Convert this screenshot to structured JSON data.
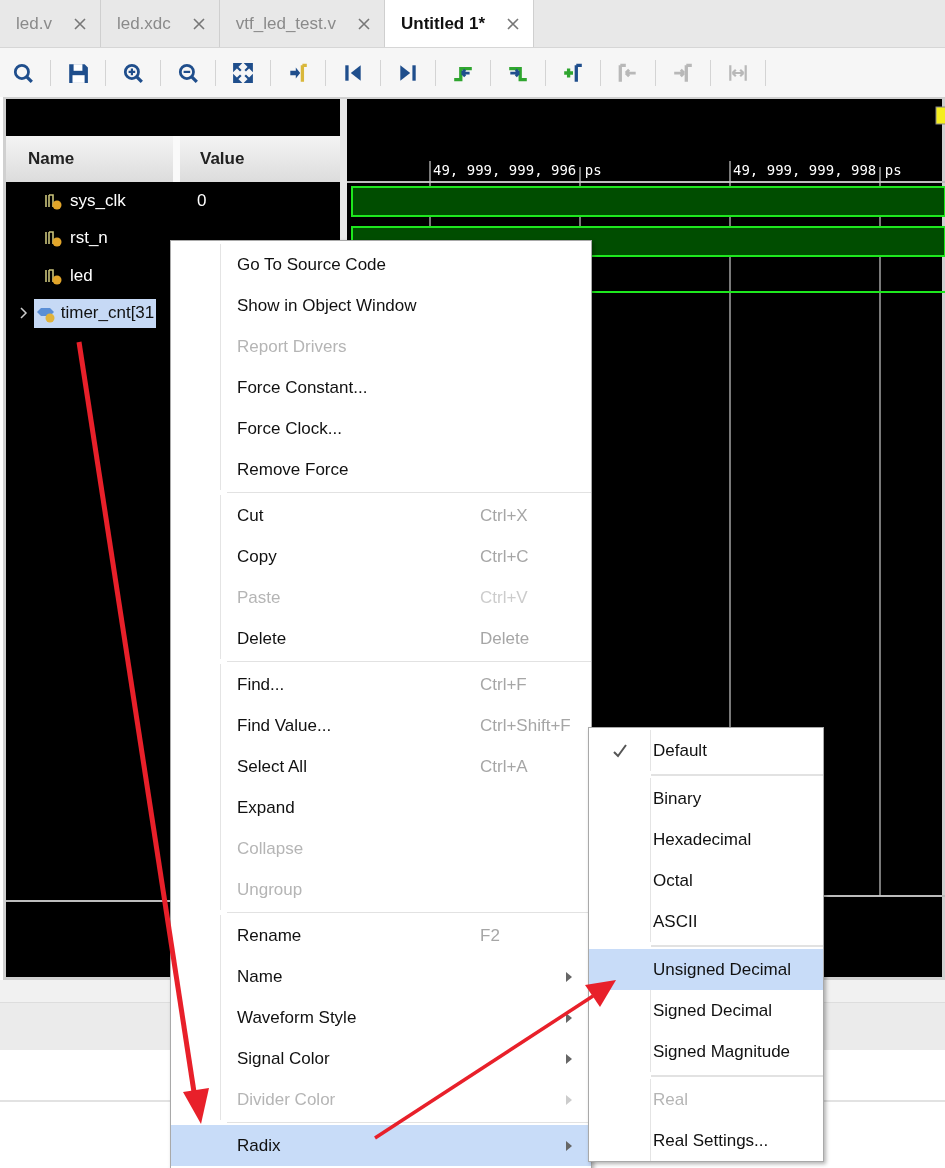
{
  "tabs": [
    {
      "label": "led.v",
      "selected": false
    },
    {
      "label": "led.xdc",
      "selected": false
    },
    {
      "label": "vtf_led_test.v",
      "selected": false
    },
    {
      "label": "Untitled 1*",
      "selected": true
    }
  ],
  "toolbar": [
    {
      "kind": "search",
      "disabled": false
    },
    {
      "kind": "save",
      "disabled": false
    },
    {
      "kind": "zoom-in",
      "disabled": false
    },
    {
      "kind": "zoom-out",
      "disabled": false
    },
    {
      "kind": "fit",
      "disabled": false
    },
    {
      "kind": "go-cursor",
      "disabled": false
    },
    {
      "kind": "go-start",
      "disabled": false
    },
    {
      "kind": "go-end",
      "disabled": false
    },
    {
      "kind": "prev-edge",
      "disabled": false
    },
    {
      "kind": "next-edge",
      "disabled": false
    },
    {
      "kind": "add-marker",
      "disabled": false
    },
    {
      "kind": "prev-marker",
      "disabled": true
    },
    {
      "kind": "next-marker",
      "disabled": true
    },
    {
      "kind": "swap",
      "disabled": true
    }
  ],
  "signals_table": {
    "columns": [
      "Name",
      "Value"
    ],
    "rows": [
      {
        "name": "sys_clk",
        "value": "0",
        "kind": "bit",
        "selected": false
      },
      {
        "name": "rst_n",
        "kind": "bit",
        "selected": false
      },
      {
        "name": "led",
        "kind": "bit",
        "selected": false
      },
      {
        "name": "timer_cnt[31",
        "kind": "bus",
        "expanded": false,
        "selected": true
      }
    ]
  },
  "waveforms": [
    {
      "kind": "band"
    },
    {
      "kind": "band"
    },
    {
      "kind": "low"
    }
  ],
  "ruler": [
    "49, 999, 999, 996 ps",
    "49, 999, 999, 998 ps"
  ],
  "context_menu": [
    {
      "kind": "item",
      "label": "Go To Source Code",
      "disabled": false,
      "selected": false
    },
    {
      "kind": "item",
      "label": "Show in Object Window",
      "disabled": false,
      "selected": false
    },
    {
      "kind": "item",
      "label": "Report Drivers",
      "disabled": true,
      "selected": false
    },
    {
      "kind": "item",
      "label": "Force Constant...",
      "disabled": false,
      "selected": false
    },
    {
      "kind": "item",
      "label": "Force Clock...",
      "disabled": false,
      "selected": false
    },
    {
      "kind": "item",
      "label": "Remove Force",
      "disabled": false,
      "selected": false
    },
    {
      "kind": "separator"
    },
    {
      "kind": "item",
      "label": "Cut",
      "shortcut": "Ctrl+X",
      "disabled": false,
      "selected": false
    },
    {
      "kind": "item",
      "label": "Copy",
      "shortcut": "Ctrl+C",
      "disabled": false,
      "selected": false
    },
    {
      "kind": "item",
      "label": "Paste",
      "shortcut": "Ctrl+V",
      "disabled": true,
      "selected": false
    },
    {
      "kind": "item",
      "label": "Delete",
      "shortcut": "Delete",
      "disabled": false,
      "selected": false
    },
    {
      "kind": "separator"
    },
    {
      "kind": "item",
      "label": "Find...",
      "shortcut": "Ctrl+F",
      "disabled": false,
      "selected": false
    },
    {
      "kind": "item",
      "label": "Find Value...",
      "shortcut": "Ctrl+Shift+F",
      "disabled": false,
      "selected": false
    },
    {
      "kind": "item",
      "label": "Select All",
      "shortcut": "Ctrl+A",
      "disabled": false,
      "selected": false
    },
    {
      "kind": "item",
      "label": "Expand",
      "disabled": false,
      "selected": false
    },
    {
      "kind": "item",
      "label": "Collapse",
      "disabled": true,
      "selected": false
    },
    {
      "kind": "item",
      "label": "Ungroup",
      "disabled": true,
      "selected": false
    },
    {
      "kind": "separator"
    },
    {
      "kind": "item",
      "label": "Rename",
      "shortcut": "F2",
      "disabled": false,
      "selected": false
    },
    {
      "kind": "item",
      "label": "Name",
      "submenu": true,
      "disabled": false,
      "selected": false
    },
    {
      "kind": "item",
      "label": "Waveform Style",
      "submenu": true,
      "disabled": false,
      "selected": false
    },
    {
      "kind": "item",
      "label": "Signal Color",
      "submenu": true,
      "disabled": false,
      "selected": false
    },
    {
      "kind": "item",
      "label": "Divider Color",
      "submenu": true,
      "disabled": true,
      "selected": false
    },
    {
      "kind": "separator"
    },
    {
      "kind": "item",
      "label": "Radix",
      "submenu": true,
      "disabled": false,
      "selected": true
    }
  ],
  "radix_submenu": [
    {
      "kind": "item",
      "label": "Default",
      "checked": true,
      "disabled": false,
      "selected": false
    },
    {
      "kind": "separator"
    },
    {
      "kind": "item",
      "label": "Binary",
      "checked": false,
      "disabled": false,
      "selected": false
    },
    {
      "kind": "item",
      "label": "Hexadecimal",
      "checked": false,
      "disabled": false,
      "selected": false
    },
    {
      "kind": "item",
      "label": "Octal",
      "checked": false,
      "disabled": false,
      "selected": false
    },
    {
      "kind": "item",
      "label": "ASCII",
      "checked": false,
      "disabled": false,
      "selected": false
    },
    {
      "kind": "separator"
    },
    {
      "kind": "item",
      "label": "Unsigned Decimal",
      "checked": false,
      "disabled": false,
      "selected": true
    },
    {
      "kind": "item",
      "label": "Signed Decimal",
      "checked": false,
      "disabled": false,
      "selected": false
    },
    {
      "kind": "item",
      "label": "Signed Magnitude",
      "checked": false,
      "disabled": false,
      "selected": false
    },
    {
      "kind": "separator"
    },
    {
      "kind": "item",
      "label": "Real",
      "checked": false,
      "disabled": true,
      "selected": false
    },
    {
      "kind": "item",
      "label": "Real Settings...",
      "checked": false,
      "disabled": false,
      "selected": false
    }
  ]
}
